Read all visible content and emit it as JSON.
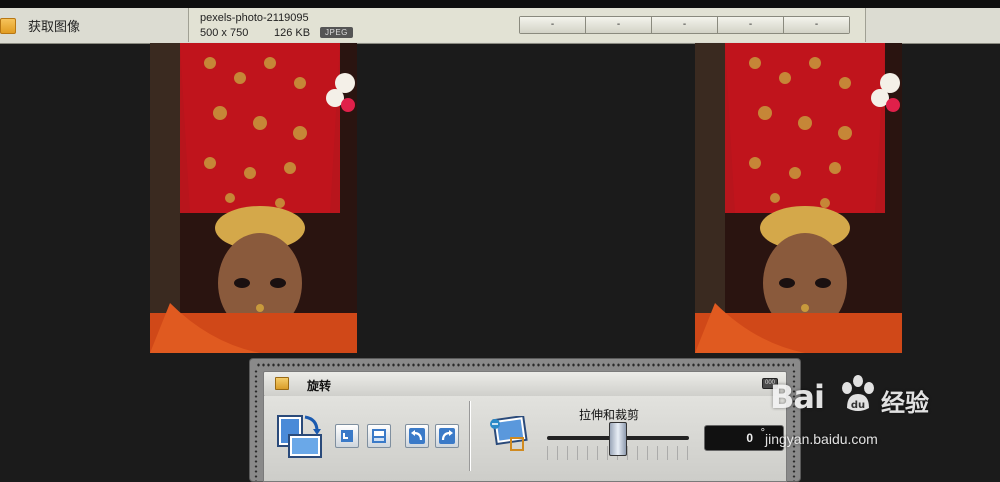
{
  "toolbar": {
    "get_image_label": "获取图像"
  },
  "file_info": {
    "name": "pexels-photo-2119095",
    "dimensions": "500 x 750",
    "size": "126 KB",
    "type": "JPEG"
  },
  "view_buttons": [
    "-",
    "-",
    "-",
    "-",
    "-"
  ],
  "rotate_panel": {
    "title": "旋转",
    "collapse_label": "000",
    "stretch_crop_label": "拉伸和裁剪",
    "angle_value": "0",
    "degree_symbol": "°",
    "slider_value_fraction": 0.5
  },
  "watermark": {
    "logo_text": "Bai",
    "logo_suffix": "经验",
    "url": "jingyan.baidu.com"
  },
  "icons": {
    "folder": "folder-icon",
    "lock": "lock-icon",
    "rotate_main": "rotate-image-icon",
    "rotate_left": "rotate-left-icon",
    "flip": "flip-image-icon",
    "undo": "undo-icon",
    "redo": "redo-icon",
    "stretch": "stretch-crop-icon",
    "paw": "baidu-paw-icon"
  },
  "colors": {
    "background": "#1b1b1b",
    "panel": "#8a8a8a",
    "accent_red": "#c0141c",
    "gold": "#c89a3c"
  }
}
